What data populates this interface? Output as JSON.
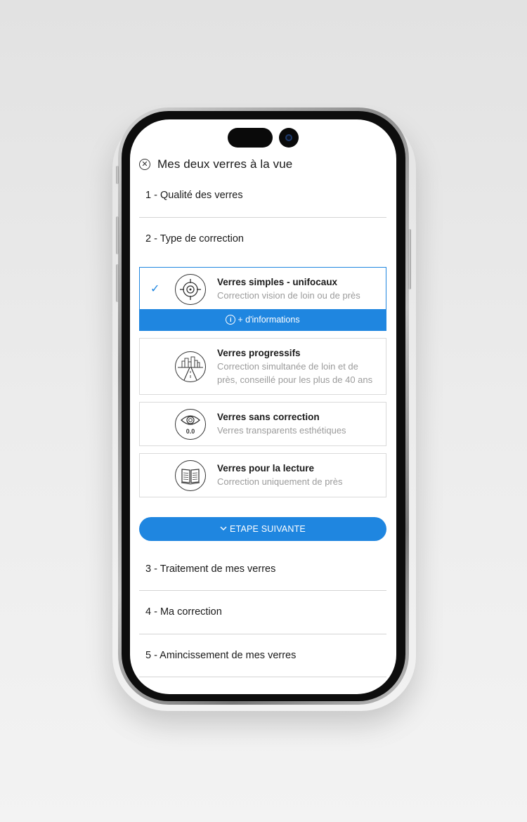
{
  "header": {
    "title": "Mes deux verres à la vue"
  },
  "steps": [
    {
      "label": "1 - Qualité des verres"
    },
    {
      "label": "2 - Type de correction"
    },
    {
      "label": "3 - Traitement de mes verres"
    },
    {
      "label": "4 - Ma correction"
    },
    {
      "label": "5 - Amincissement de mes verres"
    }
  ],
  "options": [
    {
      "title": "Verres simples - unifocaux",
      "desc": "Correction vision de loin ou de près",
      "icon": "target-icon",
      "selected": true
    },
    {
      "title": "Verres progressifs",
      "desc": "Correction simultanée de loin et de près, conseillé pour les plus de 40 ans",
      "icon": "road-city-icon",
      "selected": false
    },
    {
      "title": "Verres sans correction",
      "desc": "Verres transparents esthétiques",
      "icon": "eye-icon",
      "icon_text": "0.0",
      "selected": false
    },
    {
      "title": "Verres pour la lecture",
      "desc": "Correction uniquement de près",
      "icon": "open-book-icon",
      "selected": false
    }
  ],
  "info_bar": {
    "label": "+ d'informations"
  },
  "next_button": {
    "label": "ETAPE SUIVANTE"
  },
  "colors": {
    "accent": "#1f86e0",
    "muted_text": "#9b9b9b",
    "divider": "#d4d4d4"
  }
}
